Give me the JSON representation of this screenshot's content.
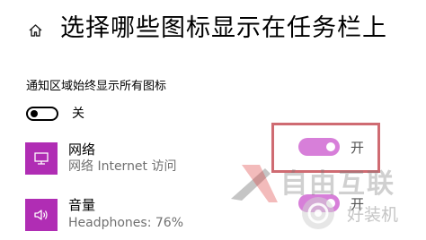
{
  "header": {
    "home_icon": "home-icon",
    "title": "选择哪些图标显示在任务栏上"
  },
  "master": {
    "label": "通知区域始终显示所有图标",
    "state": "关",
    "on": false
  },
  "apps": [
    {
      "icon": "network-icon",
      "name": "网络",
      "subtitle": "网络 Internet 访问",
      "state": "开",
      "on": true,
      "tile_color": "#b02db4"
    },
    {
      "icon": "volume-icon",
      "name": "音量",
      "subtitle": "Headphones: 76%",
      "state": "开",
      "on": true,
      "tile_color": "#b02db4"
    }
  ],
  "colors": {
    "toggle_on": "#d77fd9",
    "accent": "#b02db4",
    "highlight": "#cf6b72"
  },
  "watermarks": {
    "primary": "自由互联",
    "secondary": "好装机"
  }
}
